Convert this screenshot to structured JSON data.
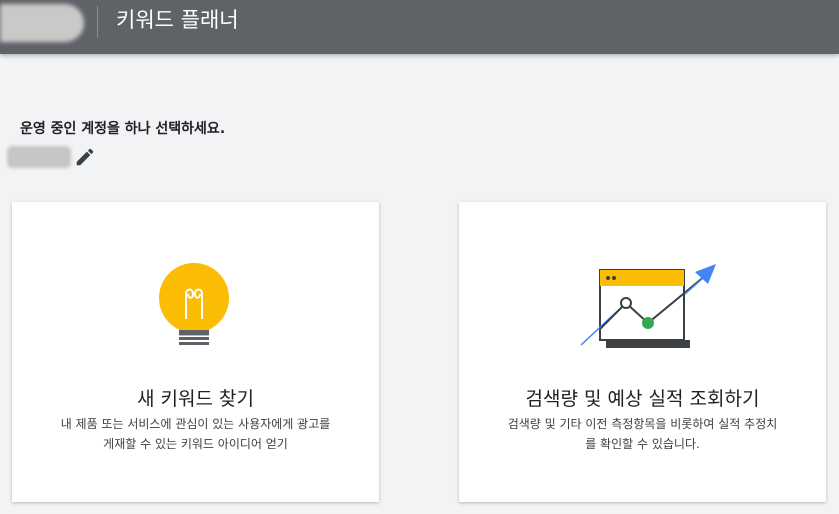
{
  "header": {
    "title": "키워드 플래너"
  },
  "account": {
    "prompt": "운영 중인 계정을 하나 선택하세요.",
    "edit_icon": "pencil-icon"
  },
  "cards": [
    {
      "icon": "lightbulb-icon",
      "title": "새 키워드 찾기",
      "desc_line1": "내 제품 또는 서비스에 관심이 있는 사용자에게 광고를",
      "desc_line2": "게재할 수 있는 키워드 아이디어 얻기"
    },
    {
      "icon": "chart-forecast-icon",
      "title": "검색량 및 예상 실적 조회하기",
      "desc_line1": "검색량 및 기타 이전 측정항목을 비롯하여 실적 추정치",
      "desc_line2": "를 확인할 수 있습니다."
    }
  ],
  "colors": {
    "header_bg": "#5f6368",
    "page_bg": "#f1f3f4",
    "bulb_yellow": "#fbbc04",
    "arrow_blue": "#4285f4",
    "point_green": "#34a853"
  }
}
